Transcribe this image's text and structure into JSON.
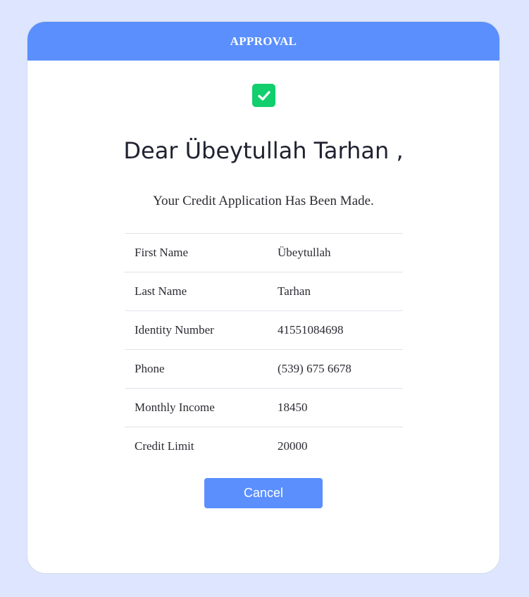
{
  "header": {
    "title": "APPROVAL"
  },
  "colors": {
    "page_background": "#dde6fe",
    "accent": "#5a8ffd",
    "success": "#11cf6d"
  },
  "status_icon": "check-square-icon",
  "greeting": {
    "prefix": "Dear",
    "first_name": "Übeytullah",
    "last_name": "Tarhan",
    "suffix": ","
  },
  "message": "Your Credit Application Has Been Made.",
  "details": [
    {
      "label": "First Name",
      "value": "Übeytullah"
    },
    {
      "label": "Last Name",
      "value": "Tarhan"
    },
    {
      "label": "Identity Number",
      "value": "41551084698"
    },
    {
      "label": "Phone",
      "value": "(539) 675 6678"
    },
    {
      "label": "Monthly Income",
      "value": "18450"
    },
    {
      "label": "Credit Limit",
      "value": "20000"
    }
  ],
  "actions": {
    "cancel_label": "Cancel"
  }
}
